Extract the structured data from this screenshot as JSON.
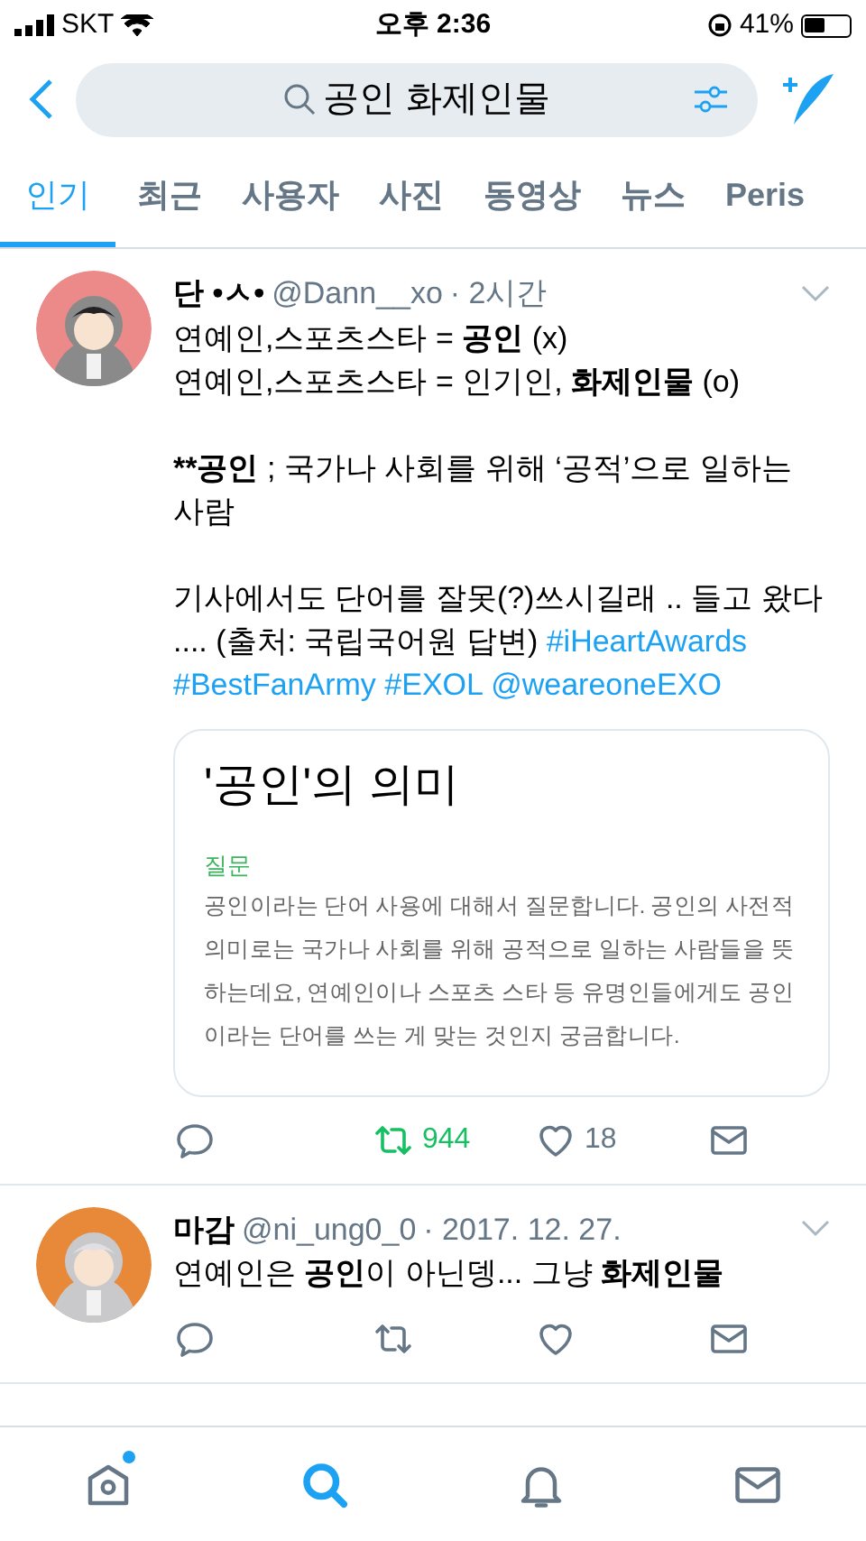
{
  "status_bar": {
    "carrier": "SKT",
    "time": "오후 2:36",
    "battery": "41%"
  },
  "search": {
    "value": "공인 화제인물"
  },
  "tabs": [
    {
      "label": "인기",
      "selected": true
    },
    {
      "label": "최근",
      "selected": false
    },
    {
      "label": "사용자",
      "selected": false
    },
    {
      "label": "사진",
      "selected": false
    },
    {
      "label": "동영상",
      "selected": false
    },
    {
      "label": "뉴스",
      "selected": false
    },
    {
      "label": "Peris",
      "selected": false
    }
  ],
  "tweets": [
    {
      "name": "단 •ㅅ•",
      "handle": "@Dann__xo",
      "time": "· 2시간",
      "paragraphs": [
        [
          {
            "kind": "text",
            "text": "연예인,스포츠스타 = **공인** (x)"
          },
          {
            "kind": "break"
          },
          {
            "kind": "text",
            "text": "연예인,스포츠스타 = 인기인, **화제인물** (o)"
          }
        ],
        [
          {
            "kind": "text",
            "text": "****공인** ; 국가나 사회를 위해 ‘공적’으로 일하는 사람"
          }
        ],
        [
          {
            "kind": "text",
            "text": "기사에서도 단어를 잘못(?)쓰시길래 .. 들고 왔다 .... (출처: 국립국어원 답변) "
          },
          {
            "kind": "link",
            "text": "#iHeartAwards"
          },
          {
            "kind": "link",
            "text": "#BestFanArmy"
          },
          {
            "kind": "link",
            "text": "#EXOL"
          },
          {
            "kind": "link",
            "text": "@weareoneEXO"
          }
        ]
      ],
      "card": {
        "title": "'공인'의 의미",
        "label": "질문",
        "body": "공인이라는 단어 사용에 대해서 질문합니다. 공인의 사전적 의미로는 국가나 사회를 위해 공적으로 일하는 사람들을 뜻하는데요, 연예인이나 스포츠 스타 등 유명인들에게도 공인이라는 단어를 쓰는 게 맞는 것인지 궁금합니다."
      },
      "retweeted": true,
      "retweets": "944",
      "liked": false,
      "likes": "18"
    },
    {
      "name": "마감",
      "handle": "@ni_ung0_0",
      "time": "· 2017. 12. 27.",
      "paragraphs": [
        [
          {
            "kind": "text",
            "text": "연예인은 **공인**이 아닌뎅... 그냥 **화제인물**"
          }
        ]
      ],
      "retweeted": false,
      "liked": false
    }
  ],
  "bottom_nav": [
    {
      "kind": "home",
      "selected": false,
      "badge": true
    },
    {
      "kind": "search",
      "selected": true,
      "badge": false
    },
    {
      "kind": "bell",
      "selected": false,
      "badge": false
    },
    {
      "kind": "mail",
      "selected": false,
      "badge": false
    }
  ]
}
